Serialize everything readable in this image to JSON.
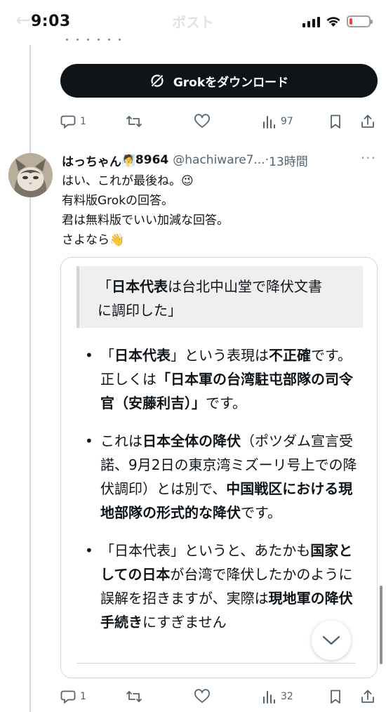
{
  "status_bar": {
    "time": "9:03",
    "faded_title": "ポスト",
    "battery_level": 0.15
  },
  "previous": {
    "remnant_text": "・・・・・・",
    "grok_button_label": "Grokをダウンロード",
    "actions": {
      "replies": "1",
      "views": "97"
    }
  },
  "reply": {
    "display_name": "はっちゃん",
    "name_emoji": "🧖",
    "name_number": "8964",
    "handle": "@hachiware7...",
    "time_sep": " · ",
    "time": "13時間",
    "text_lines": [
      "はい、これが最後ね。😉",
      "有料版Grokの回答。",
      "君は無料版でいい加減な回答。",
      "さよなら👋"
    ],
    "card": {
      "quote_line1_bold": "日本代表",
      "quote_line1_rest": "は台北中山堂で降伏文書",
      "quote_open": "「",
      "quote_line2": "に調印した」",
      "bullet1": {
        "a": "「",
        "b": "日本代表",
        "c": "」という表現は",
        "d": "不正確",
        "e": "です。正しくは",
        "f": "「日本軍の台湾駐屯部隊の司令官（安藤利吉）」",
        "g": "です。"
      },
      "bullet2": {
        "a": "これは",
        "b": "日本全体の降伏",
        "c": "（ポツダム宣言受諾、9月2日の東京湾ミズーリ号上での降伏調印）とは別で、",
        "d": "中国戦区における現地部隊の形式的な降伏",
        "e": "です。"
      },
      "bullet3": {
        "a": "「日本代表」というと、あたかも",
        "b": "国家としての日本",
        "c": "が台湾で降伏したかのように誤解を招きますが、実際は",
        "d": "現地軍の降伏手続き",
        "e": "にすぎません"
      }
    },
    "actions": {
      "replies": "1",
      "views": "32"
    }
  },
  "icons": {
    "reply": "speech-bubble-icon",
    "retweet": "repost-icon",
    "like": "heart-icon",
    "views": "bar-chart-icon",
    "bookmark": "bookmark-icon",
    "share": "share-icon",
    "grok": "grok-logo-icon",
    "scroll": "chevron-down-icon"
  },
  "colors": {
    "text": "#0f1419",
    "secondary": "#536471",
    "border": "#cfd9de",
    "button": "#0f1419",
    "battery": "#ff3b30"
  }
}
